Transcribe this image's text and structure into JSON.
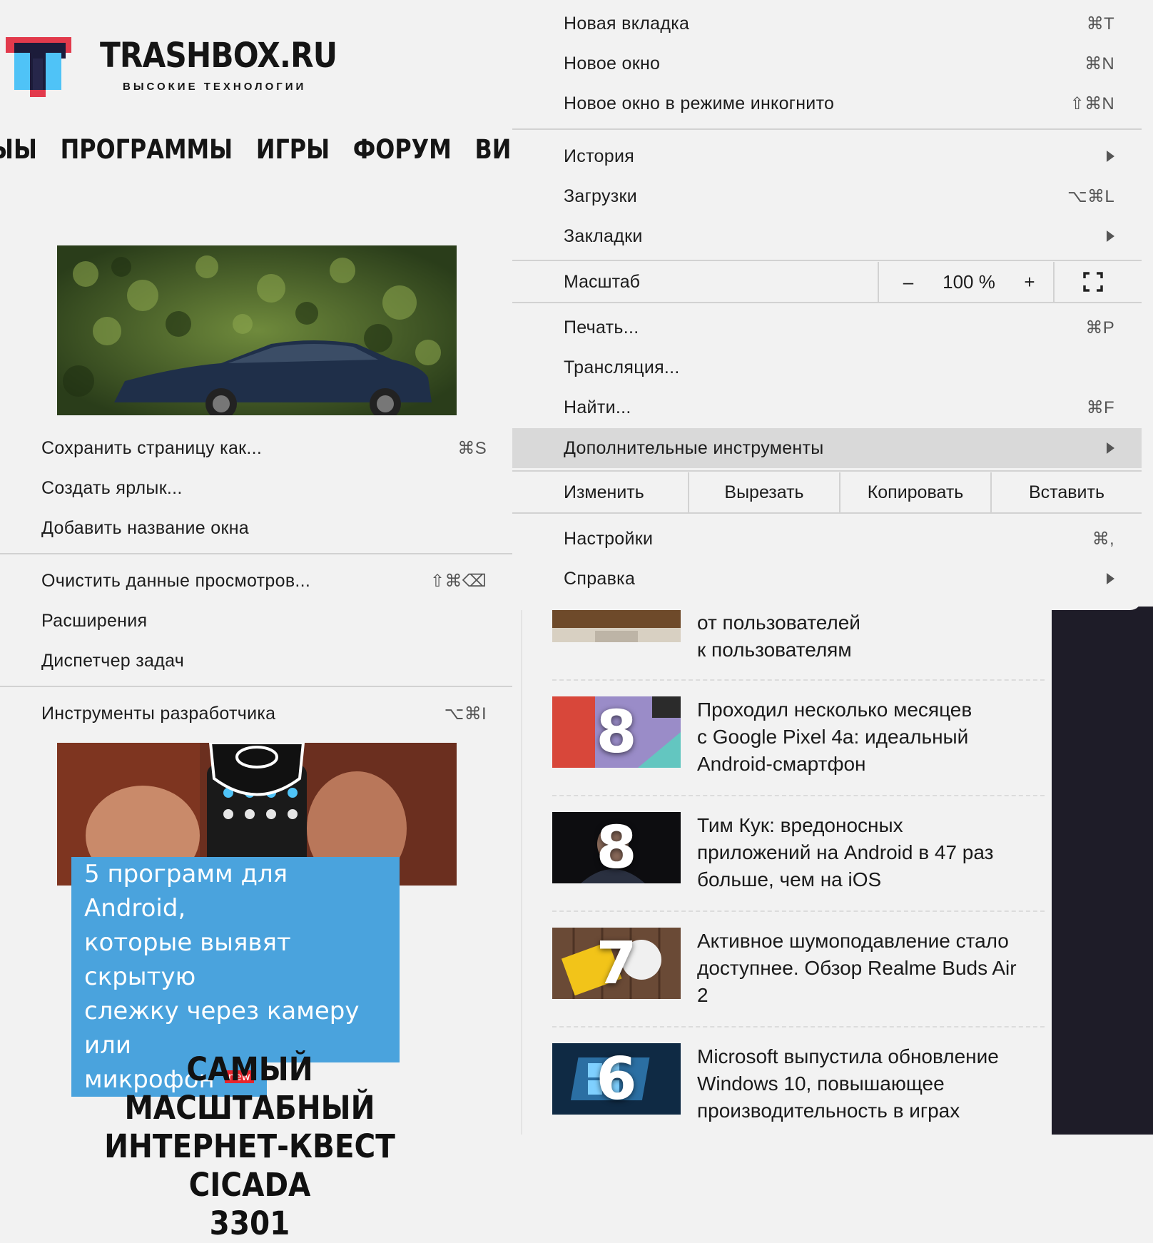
{
  "site": {
    "logo_text": "TRASHBOX.RU",
    "logo_subtitle": "ВЫСОКИЕ ТЕХНОЛОГИИ",
    "nav": [
      "ЫЫ",
      "ПРОГРАММЫ",
      "ИГРЫ",
      "ФОРУМ",
      "ВИДЕО"
    ],
    "article_title_lines": [
      "5 программ для Android,",
      "которые выявят скрытую",
      "слежку через камеру или",
      "микрофон"
    ],
    "article_badge": "new",
    "cicada_lines": [
      "САМЫЙ МАСШТАБНЫЙ",
      "ИНТЕРНЕТ-КВЕСТ CICADA",
      "3301"
    ],
    "news": [
      {
        "rank": "",
        "title_lines": [
          "от пользователей",
          "к пользователям"
        ]
      },
      {
        "rank": "8",
        "title_lines": [
          "Проходил несколько месяцев",
          "с Google Pixel 4a: идеальный",
          "Android-смартфон"
        ]
      },
      {
        "rank": "8",
        "title_lines": [
          "Тим Кук: вредоносных",
          "приложений на Android в 47 раз",
          "больше, чем на iOS"
        ]
      },
      {
        "rank": "7",
        "title_lines": [
          "Активное шумоподавление стало",
          "доступнее. Обзор Realme Buds Air",
          "2"
        ]
      },
      {
        "rank": "6",
        "title_lines": [
          "Microsoft выпустила обновление",
          "Windows 10, повышающее",
          "производительность в играх"
        ]
      }
    ]
  },
  "submenu": {
    "items": [
      {
        "label": "Сохранить страницу как...",
        "shortcut": "⌘S"
      },
      {
        "label": "Создать ярлык...",
        "shortcut": ""
      },
      {
        "label": "Добавить название окна",
        "shortcut": ""
      },
      {
        "label": "Очистить данные просмотров...",
        "shortcut": "⇧⌘⌫"
      },
      {
        "label": "Расширения",
        "shortcut": ""
      },
      {
        "label": "Диспетчер задач",
        "shortcut": ""
      },
      {
        "label": "Инструменты разработчика",
        "shortcut": "⌥⌘I"
      }
    ]
  },
  "menu": {
    "items": [
      {
        "label": "Новая вкладка",
        "shortcut": "⌘T"
      },
      {
        "label": "Новое окно",
        "shortcut": "⌘N"
      },
      {
        "label": "Новое окно в режиме инкогнито",
        "shortcut": "⇧⌘N"
      },
      {
        "label": "История",
        "shortcut": ""
      },
      {
        "label": "Загрузки",
        "shortcut": "⌥⌘L"
      },
      {
        "label": "Закладки",
        "shortcut": ""
      },
      {
        "label": "Печать...",
        "shortcut": "⌘P"
      },
      {
        "label": "Трансляция...",
        "shortcut": ""
      },
      {
        "label": "Найти...",
        "shortcut": "⌘F"
      },
      {
        "label": "Дополнительные инструменты",
        "shortcut": ""
      },
      {
        "label": "Настройки",
        "shortcut": "⌘,"
      },
      {
        "label": "Справка",
        "shortcut": ""
      }
    ],
    "zoom": {
      "label": "Масштаб",
      "minus": "–",
      "value": "100 %",
      "plus": "+"
    },
    "edit": {
      "label": "Изменить",
      "cut": "Вырезать",
      "copy": "Копировать",
      "paste": "Вставить"
    }
  },
  "colors": {
    "accent_blue": "#4aa3dd",
    "badge_red": "#e8262d",
    "logo_red": "#e23a4c",
    "logo_blue": "#4fc3f7",
    "menu_bg": "#f2f2f2",
    "menu_highlight": "#d9d9d9"
  }
}
